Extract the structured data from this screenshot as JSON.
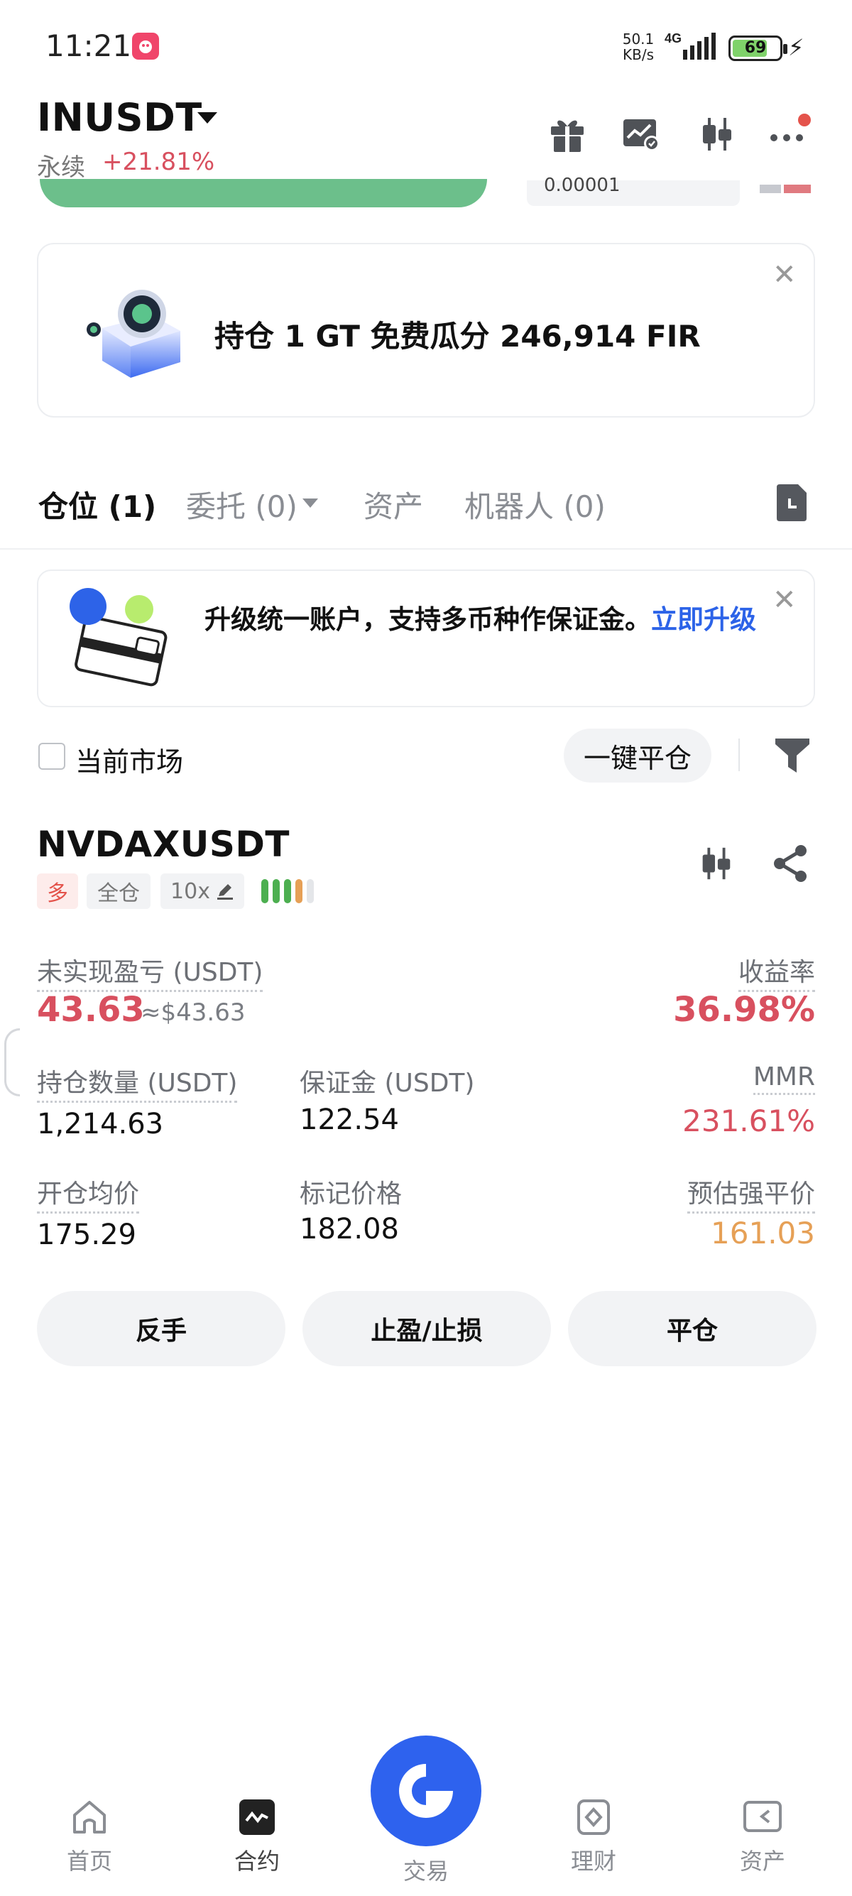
{
  "status_bar": {
    "time": "11:21",
    "net_speed": "50.1",
    "net_unit": "KB/s",
    "network": "4G",
    "battery": "69"
  },
  "header": {
    "pair": "INUSDT",
    "type": "永续",
    "change": "+21.81%",
    "partial_value": "0.00001"
  },
  "promo": {
    "text": "持仓 1 GT 免费瓜分 246,914 FIR"
  },
  "tabs": {
    "positions": "仓位 (1)",
    "orders": "委托 (0)",
    "assets": "资产",
    "bots": "机器人 (0)"
  },
  "upgrade": {
    "text": "升级统一账户，支持多币种作保证金。",
    "link": "立即升级"
  },
  "filter": {
    "market_label": "当前市场",
    "close_all": "一键平仓"
  },
  "position": {
    "symbol": "NVDAXUSDT",
    "side": "多",
    "margin_mode": "全仓",
    "leverage": "10x",
    "risk_colors": [
      "#4caf50",
      "#4caf50",
      "#4caf50",
      "#e6a056",
      "#e4e6e9"
    ],
    "unrealized_pnl_label": "未实现盈亏 (USDT)",
    "unrealized_pnl": "43.63",
    "unrealized_pnl_usd": "≈$43.63",
    "roe_label": "收益率",
    "roe": "36.98%",
    "size_label": "持仓数量 (USDT)",
    "size": "1,214.63",
    "margin_label": "保证金 (USDT)",
    "margin": "122.54",
    "mmr_label": "MMR",
    "mmr": "231.61%",
    "entry_label": "开仓均价",
    "entry": "175.29",
    "mark_label": "标记价格",
    "mark": "182.08",
    "liq_label": "预估强平价",
    "liq": "161.03"
  },
  "actions": {
    "reverse": "反手",
    "tpsl": "止盈/止损",
    "close": "平仓"
  },
  "nav": {
    "home": "首页",
    "futures": "合约",
    "trade": "交易",
    "finance": "理财",
    "assets": "资产"
  }
}
